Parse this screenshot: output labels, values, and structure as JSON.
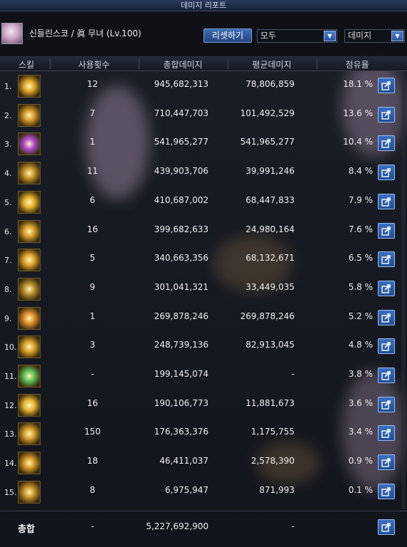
{
  "window": {
    "title": "데미지 리포트"
  },
  "header": {
    "character": "신들린스코 / 眞 무녀 (Lv.100)",
    "reset_label": "리셋하기",
    "filter": {
      "value": "모두"
    },
    "sort": {
      "value": "데미지"
    }
  },
  "columns": {
    "skill": "스킬",
    "count": "사용횟수",
    "total": "총합데미지",
    "avg": "평균데미지",
    "share": "점유율"
  },
  "rows": [
    {
      "rank": "1.",
      "count": "12",
      "total": "945,682,313",
      "avg": "78,806,859",
      "share": "18.1 %",
      "icon": "skill-icon-golden-burst",
      "color": "#e0a62a"
    },
    {
      "rank": "2.",
      "count": "7",
      "total": "710,447,703",
      "avg": "101,492,529",
      "share": "13.6 %",
      "icon": "skill-icon-cross-slash",
      "color": "#d49a2a"
    },
    {
      "rank": "3.",
      "count": "1",
      "total": "541,965,277",
      "avg": "541,965,277",
      "share": "10.4 %",
      "icon": "skill-icon-purple-spirit",
      "color": "#b04ad0"
    },
    {
      "rank": "4.",
      "count": "11",
      "total": "439,903,706",
      "avg": "39,991,246",
      "share": "8.4 %",
      "icon": "skill-icon-dragon",
      "color": "#c7962a"
    },
    {
      "rank": "5.",
      "count": "6",
      "total": "410,687,002",
      "avg": "68,447,833",
      "share": "7.9 %",
      "icon": "skill-icon-sun-bolt",
      "color": "#e3b22a"
    },
    {
      "rank": "6.",
      "count": "16",
      "total": "399,682,633",
      "avg": "24,980,164",
      "share": "7.6 %",
      "icon": "skill-icon-spiral",
      "color": "#d6a028"
    },
    {
      "rank": "7.",
      "count": "5",
      "total": "340,663,356",
      "avg": "68,132,671",
      "share": "6.5 %",
      "icon": "skill-icon-fire-wave",
      "color": "#e2a52c"
    },
    {
      "rank": "8.",
      "count": "9",
      "total": "301,041,321",
      "avg": "33,449,035",
      "share": "5.8 %",
      "icon": "skill-icon-stone-golem",
      "color": "#b8902c"
    },
    {
      "rank": "9.",
      "count": "1",
      "total": "269,878,246",
      "avg": "269,878,246",
      "share": "5.2 %",
      "icon": "skill-icon-flame-claw",
      "color": "#e0902a"
    },
    {
      "rank": "10.",
      "count": "3",
      "total": "248,739,136",
      "avg": "82,913,045",
      "share": "4.8 %",
      "icon": "skill-icon-beast-head",
      "color": "#d8a42a"
    },
    {
      "rank": "11.",
      "count": "-",
      "total": "199,145,074",
      "avg": "-",
      "share": "3.8 %",
      "icon": "skill-icon-green-spirit",
      "color": "#5fbf5a"
    },
    {
      "rank": "12.",
      "count": "16",
      "total": "190,106,773",
      "avg": "11,881,673",
      "share": "3.6 %",
      "icon": "skill-icon-light-flare",
      "color": "#e6b634"
    },
    {
      "rank": "13.",
      "count": "150",
      "total": "176,363,376",
      "avg": "1,175,755",
      "share": "3.4 %",
      "icon": "skill-icon-triple-strike",
      "color": "#d4a02a"
    },
    {
      "rank": "14.",
      "count": "18",
      "total": "46,411,037",
      "avg": "2,578,390",
      "share": "0.9 %",
      "icon": "skill-icon-dash",
      "color": "#d29a28"
    },
    {
      "rank": "15.",
      "count": "8",
      "total": "6,975,947",
      "avg": "871,993",
      "share": "0.1 %",
      "icon": "skill-icon-rune-seal",
      "color": "#c8962a"
    }
  ],
  "total": {
    "label": "총합",
    "count": "-",
    "total": "5,227,692,900",
    "avg": "-"
  }
}
